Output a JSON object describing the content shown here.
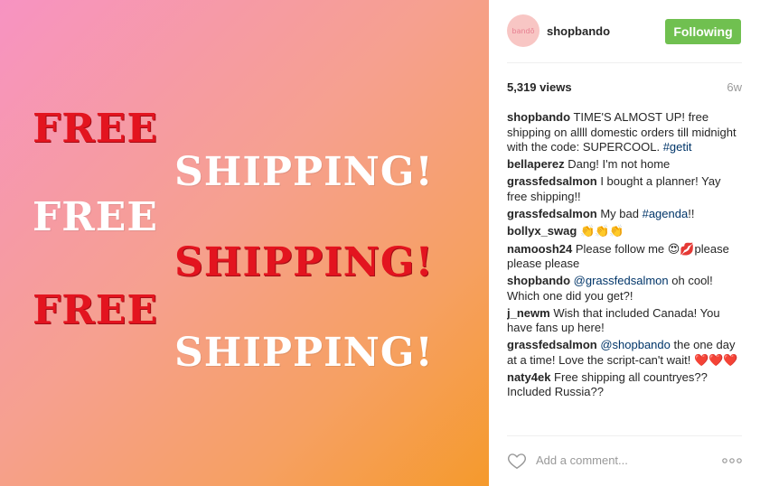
{
  "media": {
    "lines": [
      {
        "text": "FREE",
        "color": "red"
      },
      {
        "text": "SHIPPING!",
        "color": "white"
      },
      {
        "text": "FREE",
        "color": "white"
      },
      {
        "text": "SHIPPING!",
        "color": "red"
      },
      {
        "text": "FREE",
        "color": "red"
      },
      {
        "text": "SHIPPING!",
        "color": "white"
      }
    ],
    "colors": {
      "red": "#e3141f",
      "white": "#ffffff"
    }
  },
  "header": {
    "avatar_text": "bandō",
    "username": "shopbando",
    "follow_label": "Following"
  },
  "stats": {
    "views": "5,319 views",
    "age": "6w"
  },
  "comments": [
    {
      "author": "shopbando",
      "text": "TIME'S ALMOST UP! free shipping on allll domestic orders till midnight with the code: SUPERCOOL.",
      "link": "#getit",
      "after": ""
    },
    {
      "author": "bellaperez",
      "text": "Dang! I'm not home",
      "link": "",
      "after": ""
    },
    {
      "author": "grassfedsalmon",
      "text": "I bought a planner! Yay free shipping!!",
      "link": "",
      "after": ""
    },
    {
      "author": "grassfedsalmon",
      "text": "My bad",
      "link": "#agenda",
      "after": "!!"
    },
    {
      "author": "bollyx_swag",
      "text": "👏👏👏",
      "link": "",
      "after": ""
    },
    {
      "author": "namoosh24",
      "text": "Please follow me 😍💋please please please",
      "link": "",
      "after": ""
    },
    {
      "author": "shopbando",
      "text": "",
      "link": "@grassfedsalmon",
      "after": "oh cool! Which one did you get?!"
    },
    {
      "author": "j_newm",
      "text": "Wish that included Canada! You have fans up here!",
      "link": "",
      "after": ""
    },
    {
      "author": "grassfedsalmon",
      "text": "",
      "link": "@shopbando",
      "after": "the one day at a time! Love the script-can't wait! ❤️❤️❤️"
    },
    {
      "author": "naty4ek",
      "text": "Free shipping all countryes?? Included Russia??",
      "link": "",
      "after": ""
    }
  ],
  "footer": {
    "like_icon": "heart-outline-icon",
    "comment_placeholder": "Add a comment...",
    "more_icon": "ellipsis-icon"
  }
}
